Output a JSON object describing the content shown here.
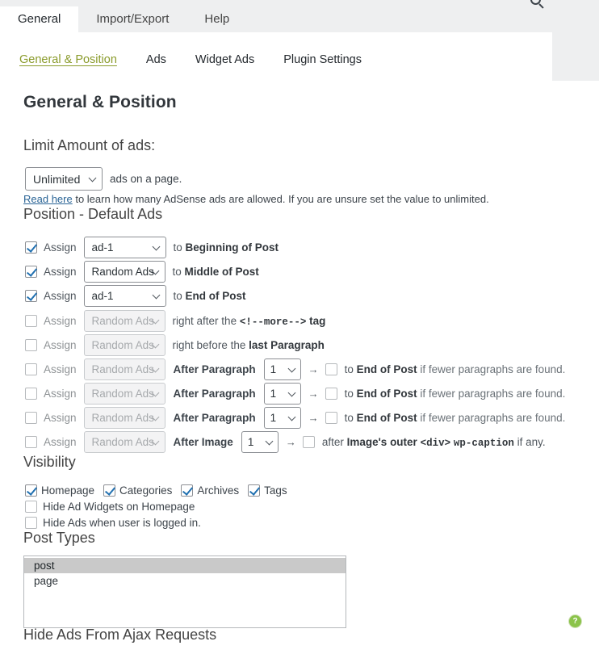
{
  "window": {
    "top_tabs": [
      {
        "label": "General",
        "active": true
      },
      {
        "label": "Import/Export",
        "active": false
      },
      {
        "label": "Help",
        "active": false
      }
    ],
    "close_icon": "search-icon"
  },
  "subtabs": [
    {
      "label": "General & Position",
      "active": true
    },
    {
      "label": "Ads",
      "active": false
    },
    {
      "label": "Widget Ads",
      "active": false
    },
    {
      "label": "Plugin Settings",
      "active": false
    }
  ],
  "page": {
    "title": "General & Position",
    "help_badge": "?"
  },
  "limit": {
    "heading": "Limit Amount of ads:",
    "select_value": "Unlimited",
    "suffix": "ads on a page.",
    "note_link": "Read here",
    "note_text": " to learn how many AdSense ads are allowed. If you are unsure set the value to unlimited."
  },
  "position": {
    "heading": "Position - Default Ads",
    "assign_label": "Assign",
    "rows": [
      {
        "checked": true,
        "enabled": true,
        "ad": "ad-1",
        "sel_width": "w-ad",
        "tail_pre": "to ",
        "tail_bold": "Beginning of Post",
        "tail_post": ""
      },
      {
        "checked": true,
        "enabled": true,
        "ad": "Random Ads",
        "sel_width": "w-rand",
        "tail_pre": "to ",
        "tail_bold": "Middle of Post",
        "tail_post": ""
      },
      {
        "checked": true,
        "enabled": true,
        "ad": "ad-1",
        "sel_width": "w-ad",
        "tail_pre": "to ",
        "tail_bold": "End of Post",
        "tail_post": ""
      },
      {
        "checked": false,
        "enabled": false,
        "ad": "Random Ads",
        "sel_width": "w-rand",
        "tail_pre": "right after the ",
        "tail_mono": "<!--more-->",
        "tail_post": " tag"
      },
      {
        "checked": false,
        "enabled": false,
        "ad": "Random Ads",
        "sel_width": "w-rand",
        "tail_pre": "right before the ",
        "tail_bold": "last Paragraph",
        "tail_post": ""
      }
    ],
    "paragraph_rows": [
      {
        "checked": false,
        "ad": "Random Ads",
        "mid_label": "After Paragraph",
        "number": "1",
        "sub_checked": false,
        "tail_pre": "to ",
        "tail_bold": "End of Post",
        "tail_post": " if fewer paragraphs are found."
      },
      {
        "checked": false,
        "ad": "Random Ads",
        "mid_label": "After Paragraph",
        "number": "1",
        "sub_checked": false,
        "tail_pre": "to ",
        "tail_bold": "End of Post",
        "tail_post": " if fewer paragraphs are found."
      },
      {
        "checked": false,
        "ad": "Random Ads",
        "mid_label": "After Paragraph",
        "number": "1",
        "sub_checked": false,
        "tail_pre": "to ",
        "tail_bold": "End of Post",
        "tail_post": " if fewer paragraphs are found."
      }
    ],
    "image_row": {
      "checked": false,
      "ad": "Random Ads",
      "mid_label": "After Image",
      "number": "1",
      "sub_checked": false,
      "tail_pre": "after ",
      "tail_bold": "Image's outer",
      "tail_mono1": "<div>",
      "tail_mono2": "wp-caption",
      "tail_post": " if any."
    },
    "arrow": "→"
  },
  "visibility": {
    "heading": "Visibility",
    "inline": [
      {
        "label": "Homepage",
        "checked": true
      },
      {
        "label": "Categories",
        "checked": true
      },
      {
        "label": "Archives",
        "checked": true
      },
      {
        "label": "Tags",
        "checked": true
      }
    ],
    "hide_widgets": {
      "label": "Hide Ad Widgets on Homepage",
      "checked": false
    },
    "hide_logged_in": {
      "label": "Hide Ads when user is logged in.",
      "checked": false
    }
  },
  "post_types": {
    "heading": "Post Types",
    "options": [
      {
        "label": "post",
        "selected": true
      },
      {
        "label": "page",
        "selected": false
      }
    ]
  },
  "ajax": {
    "heading": "Hide Ads From Ajax Requests"
  }
}
